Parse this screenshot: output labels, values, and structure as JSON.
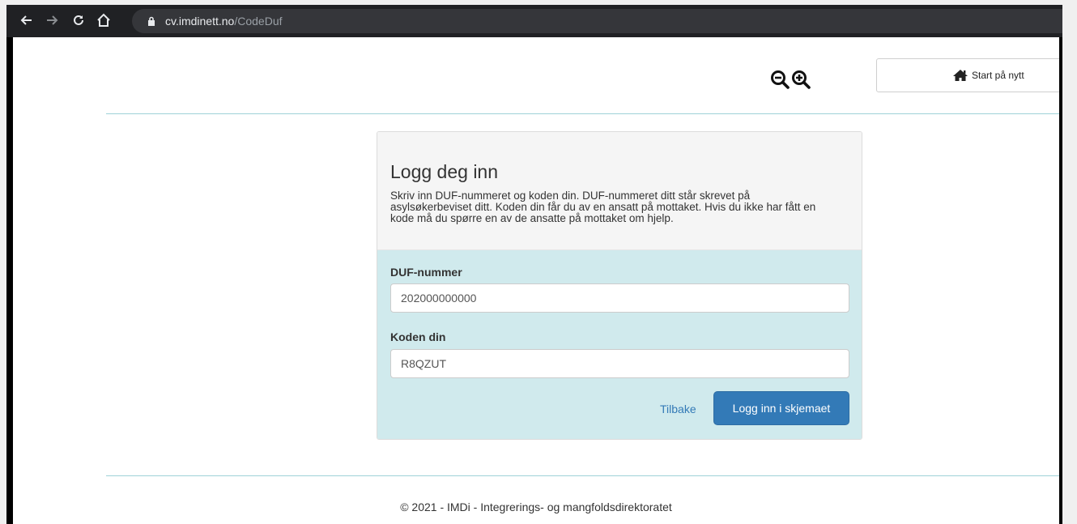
{
  "browser": {
    "url_host": "cv.imdinett.no",
    "url_path": "/CodeDuf"
  },
  "header": {
    "zoom_out_icon": "magnifier-minus",
    "zoom_in_icon": "magnifier-plus",
    "start_over_label": "Start på nytt"
  },
  "login": {
    "title": "Logg deg inn",
    "description": "Skriv inn DUF-nummeret og koden din. DUF-nummeret ditt står skrevet på asylsøkerbeviset ditt. Koden din får du av en ansatt på mottaket. Hvis du ikke har fått en kode må du spørre en av de ansatte på mottaket om hjelp.",
    "duf_label": "DUF-nummer",
    "duf_value": "202000000000",
    "code_label": "Koden din",
    "code_value": "R8QZUT",
    "back_label": "Tilbake",
    "submit_label": "Logg inn i skjemaet"
  },
  "footer": {
    "text": "© 2021 - IMDi - Integrerings- og mangfoldsdirektoratet"
  },
  "colors": {
    "primary": "#337ab7",
    "panel_bg": "#d0eaed",
    "divider": "#9fd2d8"
  }
}
